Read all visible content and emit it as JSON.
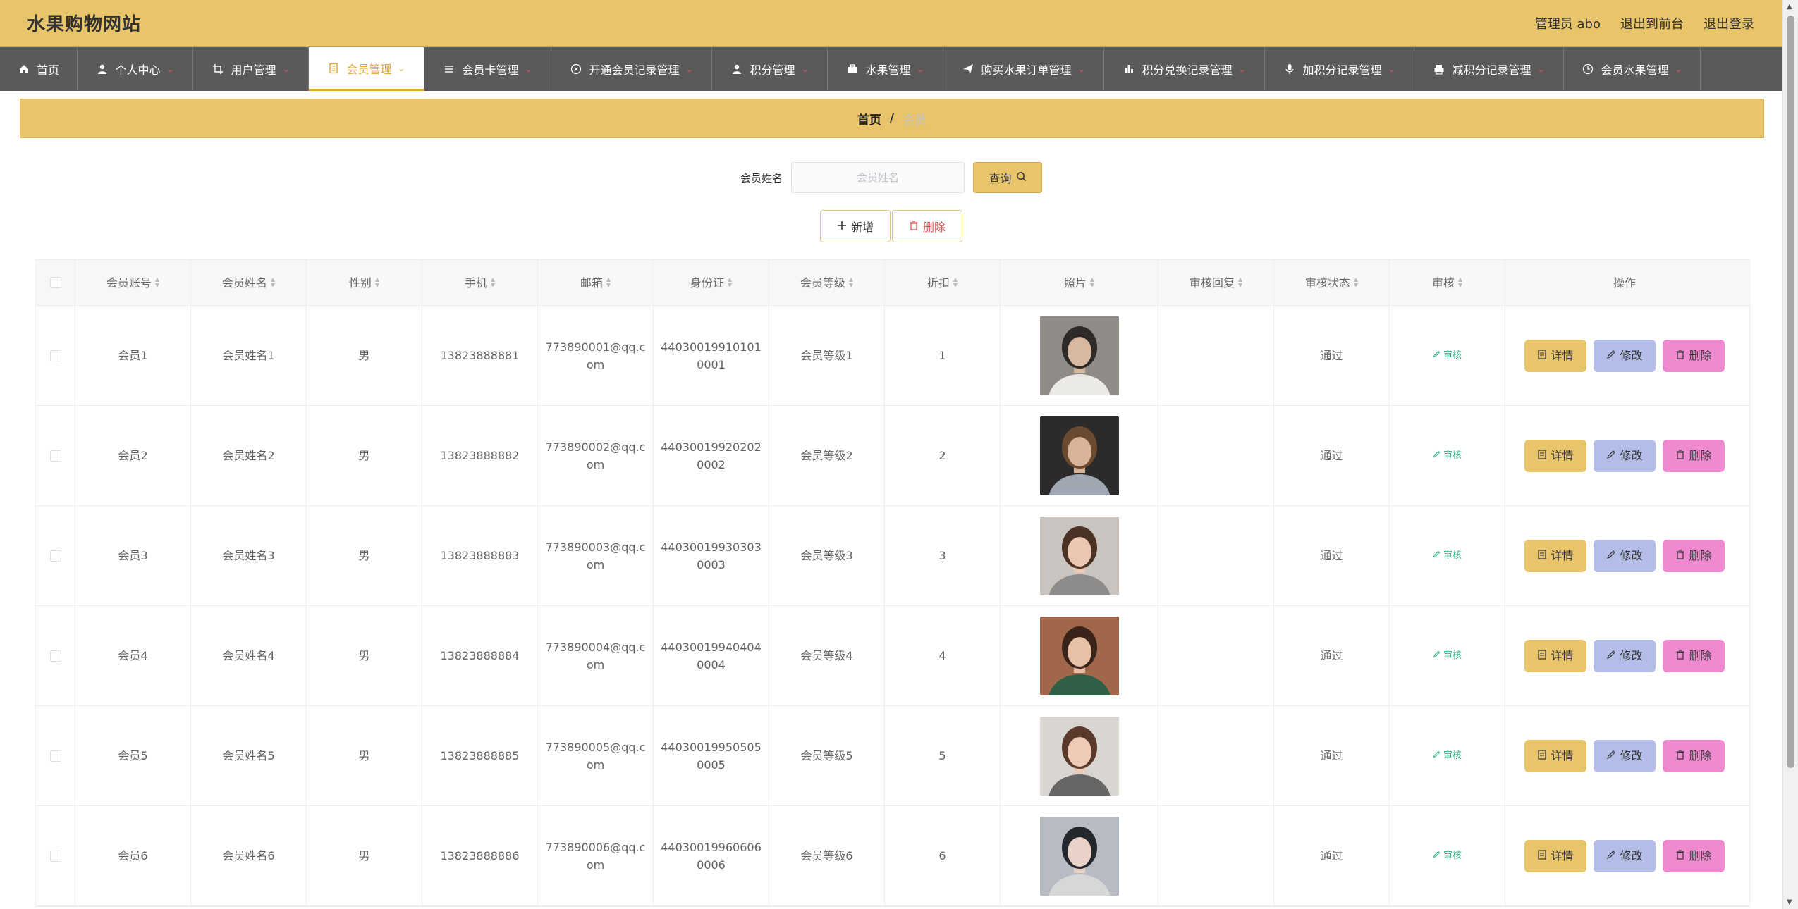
{
  "header": {
    "site_title": "水果购物网站",
    "admin_label": "管理员 abo",
    "to_front": "退出到前台",
    "logout": "退出登录"
  },
  "nav": [
    {
      "label": "首页",
      "icon": "home-icon",
      "active": false,
      "caret": false
    },
    {
      "label": "个人中心",
      "icon": "user-icon",
      "active": false,
      "caret": true
    },
    {
      "label": "用户管理",
      "icon": "crop-icon",
      "active": false,
      "caret": true
    },
    {
      "label": "会员管理",
      "icon": "document-icon",
      "active": true,
      "caret": true
    },
    {
      "label": "会员卡管理",
      "icon": "list-icon",
      "active": false,
      "caret": true
    },
    {
      "label": "开通会员记录管理",
      "icon": "compass-icon",
      "active": false,
      "caret": true
    },
    {
      "label": "积分管理",
      "icon": "user-icon",
      "active": false,
      "caret": true
    },
    {
      "label": "水果管理",
      "icon": "briefcase-icon",
      "active": false,
      "caret": true
    },
    {
      "label": "购买水果订单管理",
      "icon": "send-icon",
      "active": false,
      "caret": true
    },
    {
      "label": "积分兑换记录管理",
      "icon": "chart-icon",
      "active": false,
      "caret": true
    },
    {
      "label": "加积分记录管理",
      "icon": "microphone-icon",
      "active": false,
      "caret": true
    },
    {
      "label": "减积分记录管理",
      "icon": "printer-icon",
      "active": false,
      "caret": true
    },
    {
      "label": "会员水果管理",
      "icon": "clock-icon",
      "active": false,
      "caret": true
    }
  ],
  "breadcrumb": {
    "home": "首页",
    "separator": "/",
    "current": "会员"
  },
  "search": {
    "label": "会员姓名",
    "placeholder": "会员姓名",
    "value": "",
    "button": "查询"
  },
  "actions": {
    "add": "新增",
    "delete": "删除"
  },
  "table": {
    "columns": [
      "会员账号",
      "会员姓名",
      "性别",
      "手机",
      "邮箱",
      "身份证",
      "会员等级",
      "折扣",
      "照片",
      "审核回复",
      "审核状态",
      "审核",
      "操作"
    ],
    "rows": [
      {
        "account": "会员1",
        "name": "会员姓名1",
        "gender": "男",
        "phone": "13823888881",
        "email": "773890001@qq.com",
        "id_card": "440300199101010001",
        "level": "会员等级1",
        "discount": "1",
        "reply": "",
        "status": "通过",
        "audit": "审核"
      },
      {
        "account": "会员2",
        "name": "会员姓名2",
        "gender": "男",
        "phone": "13823888882",
        "email": "773890002@qq.com",
        "id_card": "440300199202020002",
        "level": "会员等级2",
        "discount": "2",
        "reply": "",
        "status": "通过",
        "audit": "审核"
      },
      {
        "account": "会员3",
        "name": "会员姓名3",
        "gender": "男",
        "phone": "13823888883",
        "email": "773890003@qq.com",
        "id_card": "440300199303030003",
        "level": "会员等级3",
        "discount": "3",
        "reply": "",
        "status": "通过",
        "audit": "审核"
      },
      {
        "account": "会员4",
        "name": "会员姓名4",
        "gender": "男",
        "phone": "13823888884",
        "email": "773890004@qq.com",
        "id_card": "440300199404040004",
        "level": "会员等级4",
        "discount": "4",
        "reply": "",
        "status": "通过",
        "audit": "审核"
      },
      {
        "account": "会员5",
        "name": "会员姓名5",
        "gender": "男",
        "phone": "13823888885",
        "email": "773890005@qq.com",
        "id_card": "440300199505050005",
        "level": "会员等级5",
        "discount": "5",
        "reply": "",
        "status": "通过",
        "audit": "审核"
      },
      {
        "account": "会员6",
        "name": "会员姓名6",
        "gender": "男",
        "phone": "13823888886",
        "email": "773890006@qq.com",
        "id_card": "440300199606060006",
        "level": "会员等级6",
        "discount": "6",
        "reply": "",
        "status": "通过",
        "audit": "审核"
      }
    ],
    "row_buttons": {
      "detail": "详情",
      "edit": "修改",
      "delete": "删除"
    }
  },
  "colors": {
    "accent": "#e8c46b",
    "nav_bg": "#5a5a5a",
    "edit_btn": "#b3bde8",
    "delete_btn": "#f08ad0",
    "audit_link": "#2fb58a"
  }
}
